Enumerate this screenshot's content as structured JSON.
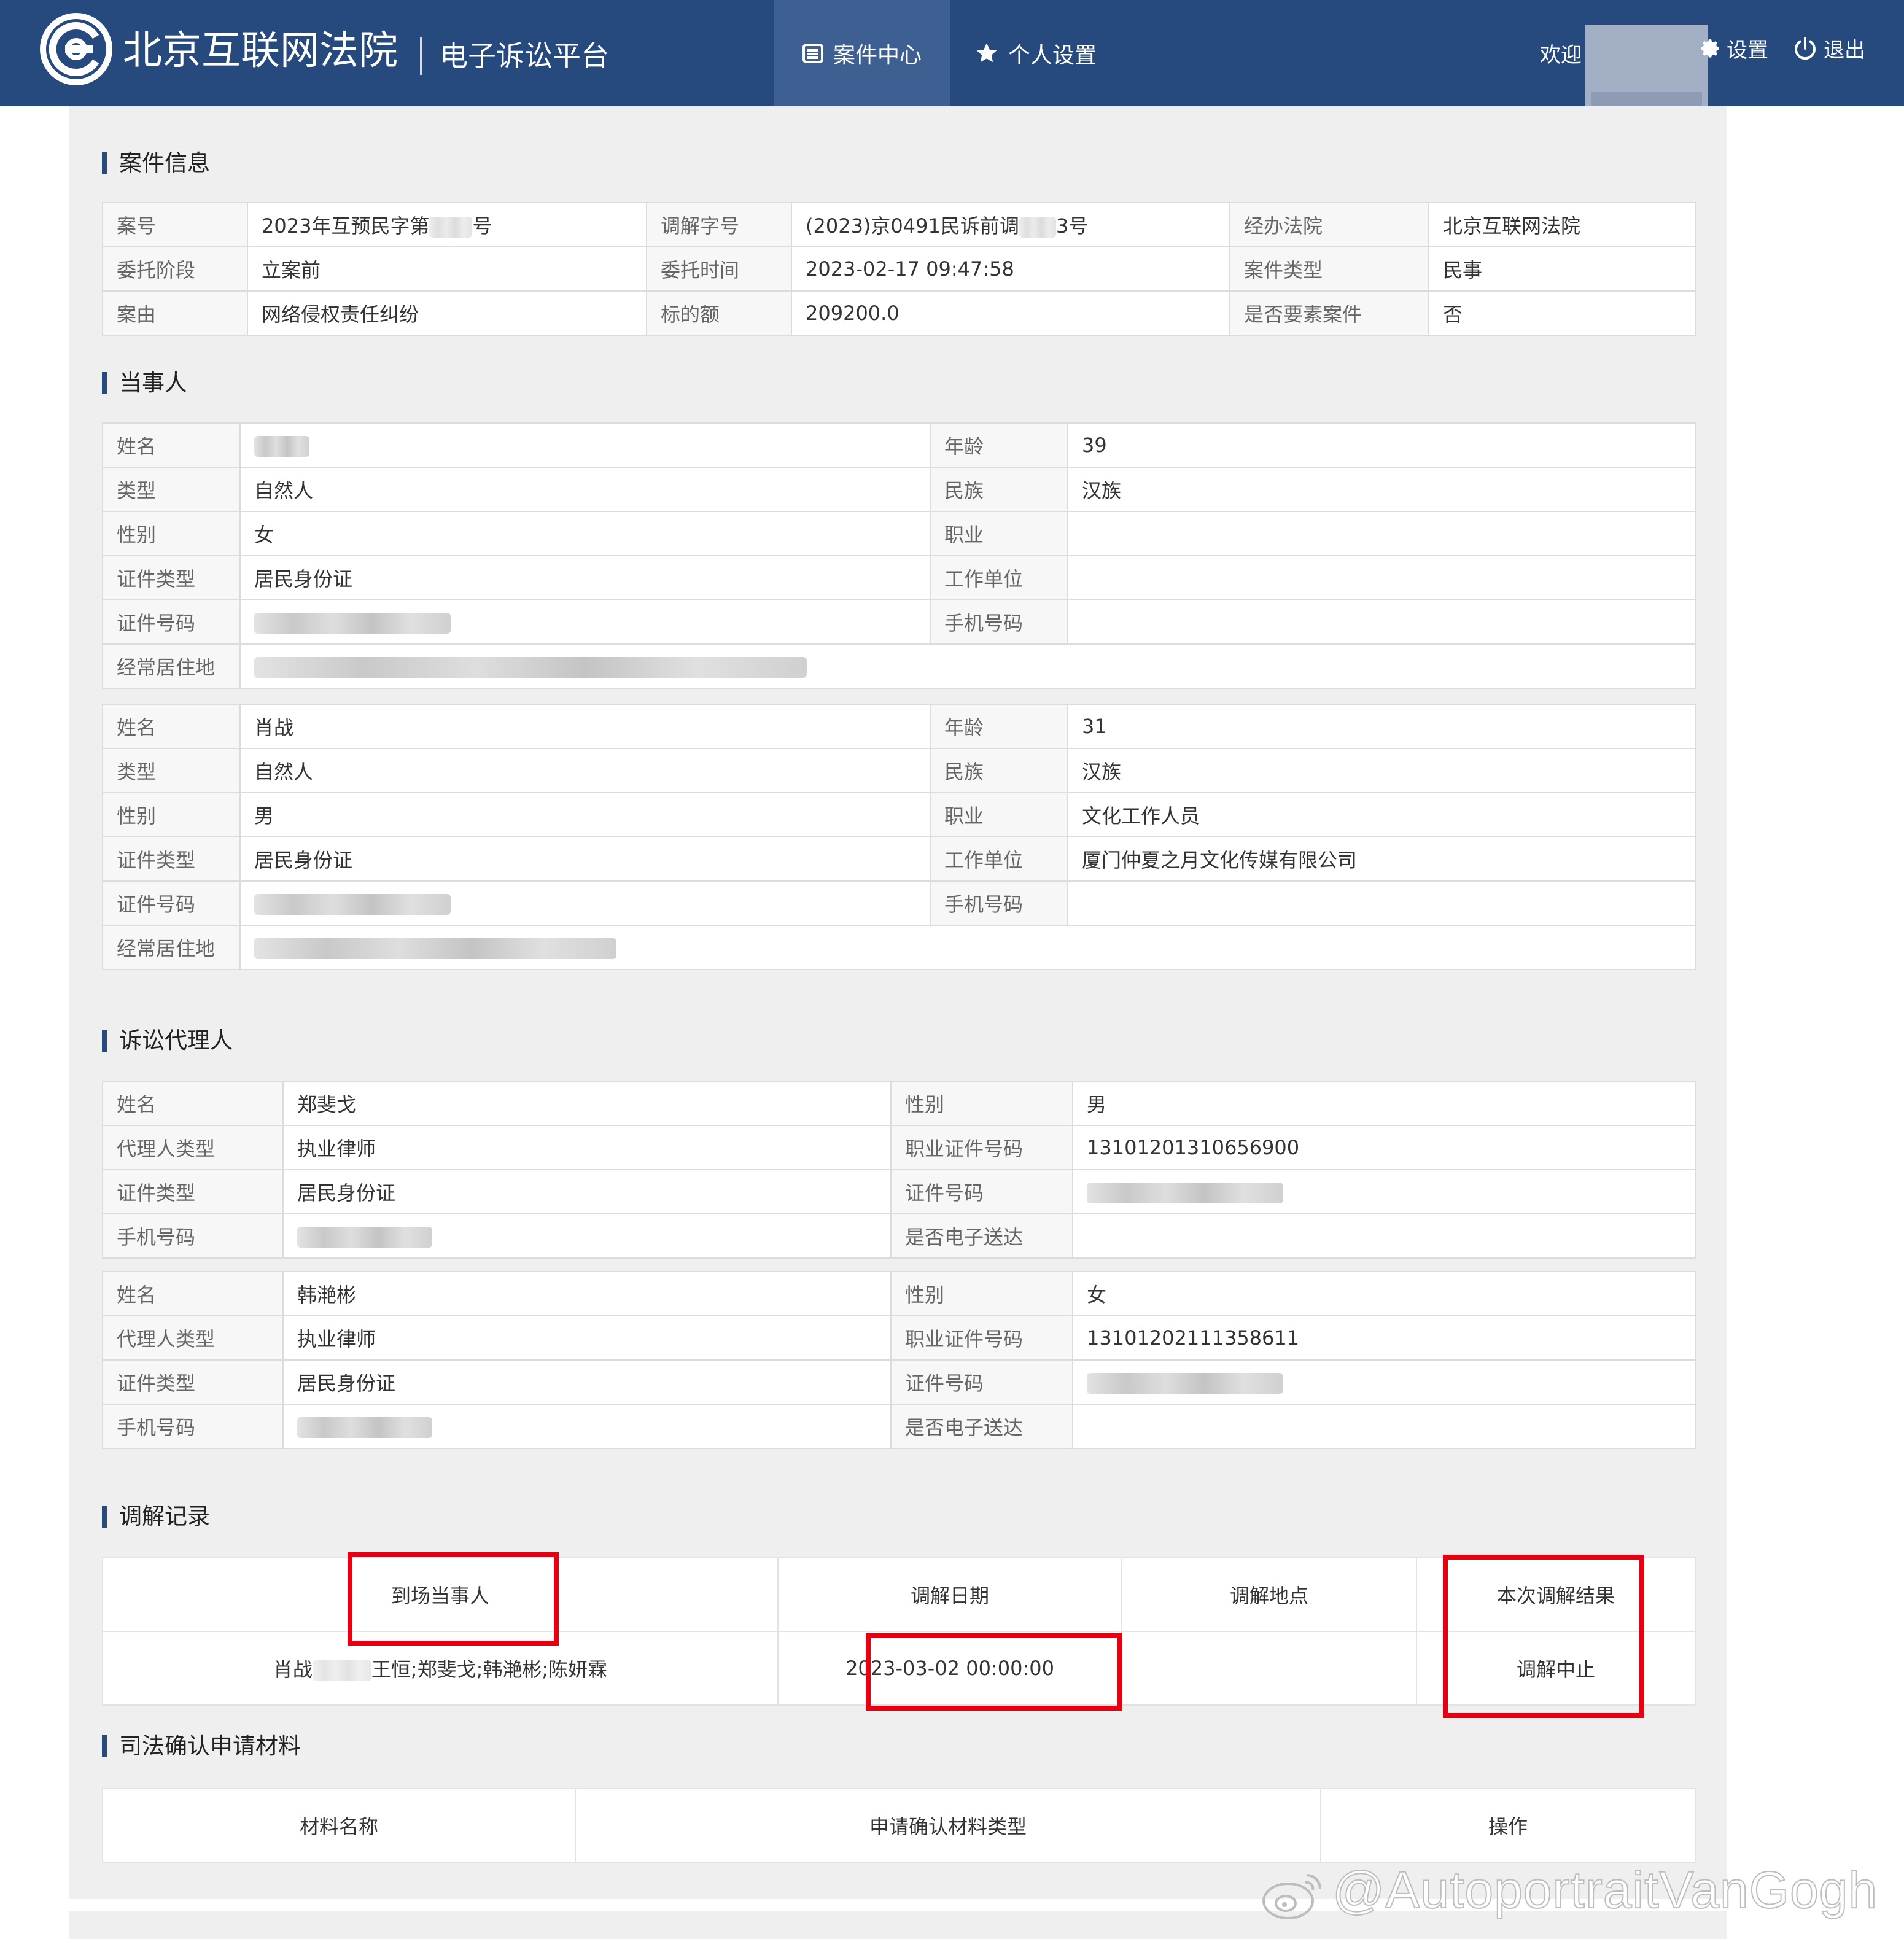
{
  "header": {
    "court_name": "北京互联网法院",
    "platform_name": "电子诉讼平台",
    "nav": [
      {
        "label": "案件中心",
        "icon": "list-icon",
        "active": true
      },
      {
        "label": "个人设置",
        "icon": "star-icon",
        "active": false
      }
    ],
    "welcome": "欢迎",
    "settings_label": "设置",
    "logout_label": "退出",
    "brand_color": "#264a7d"
  },
  "case_info": {
    "title": "案件信息",
    "rows": [
      [
        "案号",
        "2023年互预民字第",
        "号",
        "调解字号",
        "(2023)京0491民诉前调",
        "3号",
        "经办法院",
        "北京互联网法院"
      ],
      [
        "委托阶段",
        "立案前",
        "",
        "委托时间",
        "2023-02-17 09:47:58",
        "",
        "案件类型",
        "民事"
      ],
      [
        "案由",
        "网络侵权责任纠纷",
        "",
        "标的额",
        "209200.0",
        "",
        "是否要素案件",
        "否"
      ]
    ]
  },
  "parties": {
    "title": "当事人",
    "party1": {
      "name_label": "姓名",
      "age_label": "年龄",
      "age": "39",
      "type_label": "类型",
      "type": "自然人",
      "ethnic_label": "民族",
      "ethnic": "汉族",
      "gender_label": "性别",
      "gender": "女",
      "job_label": "职业",
      "job": "",
      "id_type_label": "证件类型",
      "id_type": "居民身份证",
      "employer_label": "工作单位",
      "employer": "",
      "id_no_label": "证件号码",
      "phone_label": "手机号码",
      "phone": "",
      "address_label": "经常居住地"
    },
    "party2": {
      "name_label": "姓名",
      "name": "肖战",
      "age_label": "年龄",
      "age": "31",
      "type_label": "类型",
      "type": "自然人",
      "ethnic_label": "民族",
      "ethnic": "汉族",
      "gender_label": "性别",
      "gender": "男",
      "job_label": "职业",
      "job": "文化工作人员",
      "id_type_label": "证件类型",
      "id_type": "居民身份证",
      "employer_label": "工作单位",
      "employer": "厦门仲夏之月文化传媒有限公司",
      "id_no_label": "证件号码",
      "phone_label": "手机号码",
      "phone": "",
      "address_label": "经常居住地"
    }
  },
  "agents": {
    "title": "诉讼代理人",
    "agent1": {
      "name_label": "姓名",
      "name": "郑斐戈",
      "gender_label": "性别",
      "gender": "男",
      "type_label": "代理人类型",
      "type": "执业律师",
      "license_label": "职业证件号码",
      "license": "13101201310656900",
      "id_type_label": "证件类型",
      "id_type": "居民身份证",
      "id_no_label": "证件号码",
      "phone_label": "手机号码",
      "e_service_label": "是否电子送达",
      "e_service": ""
    },
    "agent2": {
      "name_label": "姓名",
      "name": "韩滟彬",
      "gender_label": "性别",
      "gender": "女",
      "type_label": "代理人类型",
      "type": "执业律师",
      "license_label": "职业证件号码",
      "license": "13101202111358611",
      "id_type_label": "证件类型",
      "id_type": "居民身份证",
      "id_no_label": "证件号码",
      "phone_label": "手机号码",
      "e_service_label": "是否电子送达",
      "e_service": ""
    }
  },
  "mediation": {
    "title": "调解记录",
    "headers": [
      "到场当事人",
      "调解日期",
      "调解地点",
      "本次调解结果"
    ],
    "row": {
      "attendees_a": "肖战",
      "attendees_b": "王恒;郑斐戈;韩滟彬;陈妍霖",
      "date": "2023-03-02 00:00:00",
      "location": "",
      "result": "调解中止"
    },
    "highlight_color": "#e60012"
  },
  "materials": {
    "title": "司法确认申请材料",
    "headers": [
      "材料名称",
      "申请确认材料类型",
      "操作"
    ]
  },
  "watermark": "@AutoportraitVanGogh"
}
